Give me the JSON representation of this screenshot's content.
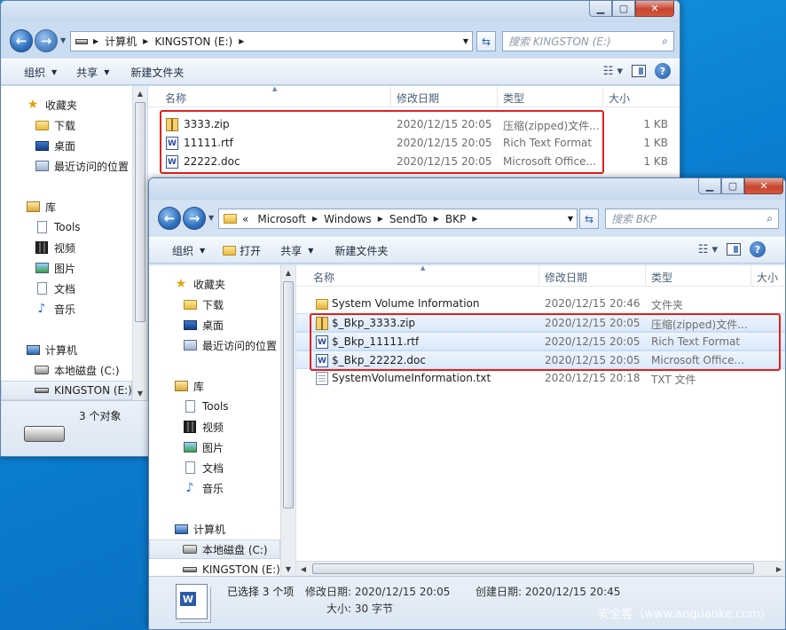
{
  "window1": {
    "address": {
      "crumbs": [
        "计算机",
        "KINGSTON (E:)"
      ]
    },
    "search_placeholder": "搜索 KINGSTON (E:)",
    "toolbar": {
      "organize": "组织",
      "share": "共享",
      "new_folder": "新建文件夹"
    },
    "nav": {
      "favorites": "收藏夹",
      "downloads": "下载",
      "desktop": "桌面",
      "recent": "最近访问的位置",
      "libraries": "库",
      "tools": "Tools",
      "videos": "视频",
      "pictures": "图片",
      "documents": "文档",
      "music": "音乐",
      "computer": "计算机",
      "local_disk": "本地磁盘 (C:)",
      "kingston": "KINGSTON (E:)"
    },
    "columns": {
      "name": "名称",
      "date": "修改日期",
      "type": "类型",
      "size": "大小"
    },
    "files": [
      {
        "name": "3333.zip",
        "date": "2020/12/15 20:05",
        "type": "压缩(zipped)文件...",
        "size": "1 KB",
        "icon": "zip-icon"
      },
      {
        "name": "11111.rtf",
        "date": "2020/12/15 20:05",
        "type": "Rich Text Format",
        "size": "1 KB",
        "icon": "rtf-icon"
      },
      {
        "name": "22222.doc",
        "date": "2020/12/15 20:05",
        "type": "Microsoft Office...",
        "size": "1 KB",
        "icon": "doc-icon"
      }
    ],
    "status": {
      "count": "3 个对象"
    }
  },
  "window2": {
    "address": {
      "overflow": "«",
      "crumbs": [
        "Microsoft",
        "Windows",
        "SendTo",
        "BKP"
      ]
    },
    "search_placeholder": "搜索 BKP",
    "toolbar": {
      "organize": "组织",
      "open": "打开",
      "share": "共享",
      "new_folder": "新建文件夹"
    },
    "nav": {
      "favorites": "收藏夹",
      "downloads": "下载",
      "desktop": "桌面",
      "recent": "最近访问的位置",
      "libraries": "库",
      "tools": "Tools",
      "videos": "视频",
      "pictures": "图片",
      "documents": "文档",
      "music": "音乐",
      "computer": "计算机",
      "local_disk": "本地磁盘 (C:)",
      "kingston": "KINGSTON (E:)"
    },
    "columns": {
      "name": "名称",
      "date": "修改日期",
      "type": "类型",
      "size": "大小"
    },
    "files": [
      {
        "name": "System Volume Information",
        "date": "2020/12/15 20:46",
        "type": "文件夹",
        "icon": "folder-icon"
      },
      {
        "name": "$_Bkp_3333.zip",
        "date": "2020/12/15 20:05",
        "type": "压缩(zipped)文件...",
        "icon": "zip-icon"
      },
      {
        "name": "$_Bkp_11111.rtf",
        "date": "2020/12/15 20:05",
        "type": "Rich Text Format",
        "icon": "rtf-icon"
      },
      {
        "name": "$_Bkp_22222.doc",
        "date": "2020/12/15 20:05",
        "type": "Microsoft Office...",
        "icon": "doc-icon"
      },
      {
        "name": "SystemVolumeInformation.txt",
        "date": "2020/12/15 20:18",
        "type": "TXT 文件",
        "icon": "txt-icon"
      }
    ],
    "status": {
      "selected": "已选择 3 个项",
      "modified": "修改日期: 2020/12/15 20:05",
      "created": "创建日期: 2020/12/15 20:45",
      "size": "大小: 30 字节"
    }
  },
  "watermark": "安全客（www.anquanke.com）"
}
